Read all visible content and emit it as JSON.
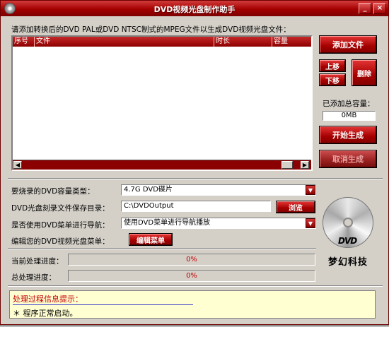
{
  "window": {
    "title": "DVD视频光盘制作助手",
    "minimize": "_",
    "close": "×"
  },
  "list": {
    "label": "请添加转换后的DVD PAL或DVD NTSC制式的MPEG文件以生成DVD视频光盘文件：",
    "columns": [
      "序号",
      "文件",
      "时长",
      "容量"
    ],
    "rows": []
  },
  "actions": {
    "add_file": "添加文件",
    "move_up": "上移",
    "move_down": "下移",
    "delete": "删除",
    "capacity_label": "已添加总容量：",
    "capacity_value": "0MB",
    "start": "开始生成",
    "cancel": "取消生成"
  },
  "settings": {
    "disc_type_label": "要烧录的DVD容量类型：",
    "disc_type_value": "4.7G DVD碟片",
    "save_dir_label": "DVD光盘刻录文件保存目录：",
    "save_dir_value": "C:\\DVDOutput",
    "browse": "浏览",
    "menu_nav_label": "是否使用DVD菜单进行导航：",
    "menu_nav_value": "使用DVD菜单进行导航播放",
    "edit_menu_label": "编辑您的DVD视频光盘菜单：",
    "edit_menu_button": "编辑菜单"
  },
  "progress": {
    "current_label": "当前处理进度：",
    "current_percent": 0,
    "current_text": "0%",
    "total_label": "总处理进度：",
    "total_percent": 0,
    "total_text": "0%"
  },
  "branding": {
    "dvd_logo": "DVD",
    "company": "梦幻科技"
  },
  "log": {
    "title": "处理过程信息提示：",
    "message": "＊ 程序正常启动。"
  },
  "colors": {
    "accent": "#a40000",
    "progress_text": "#c00000"
  }
}
